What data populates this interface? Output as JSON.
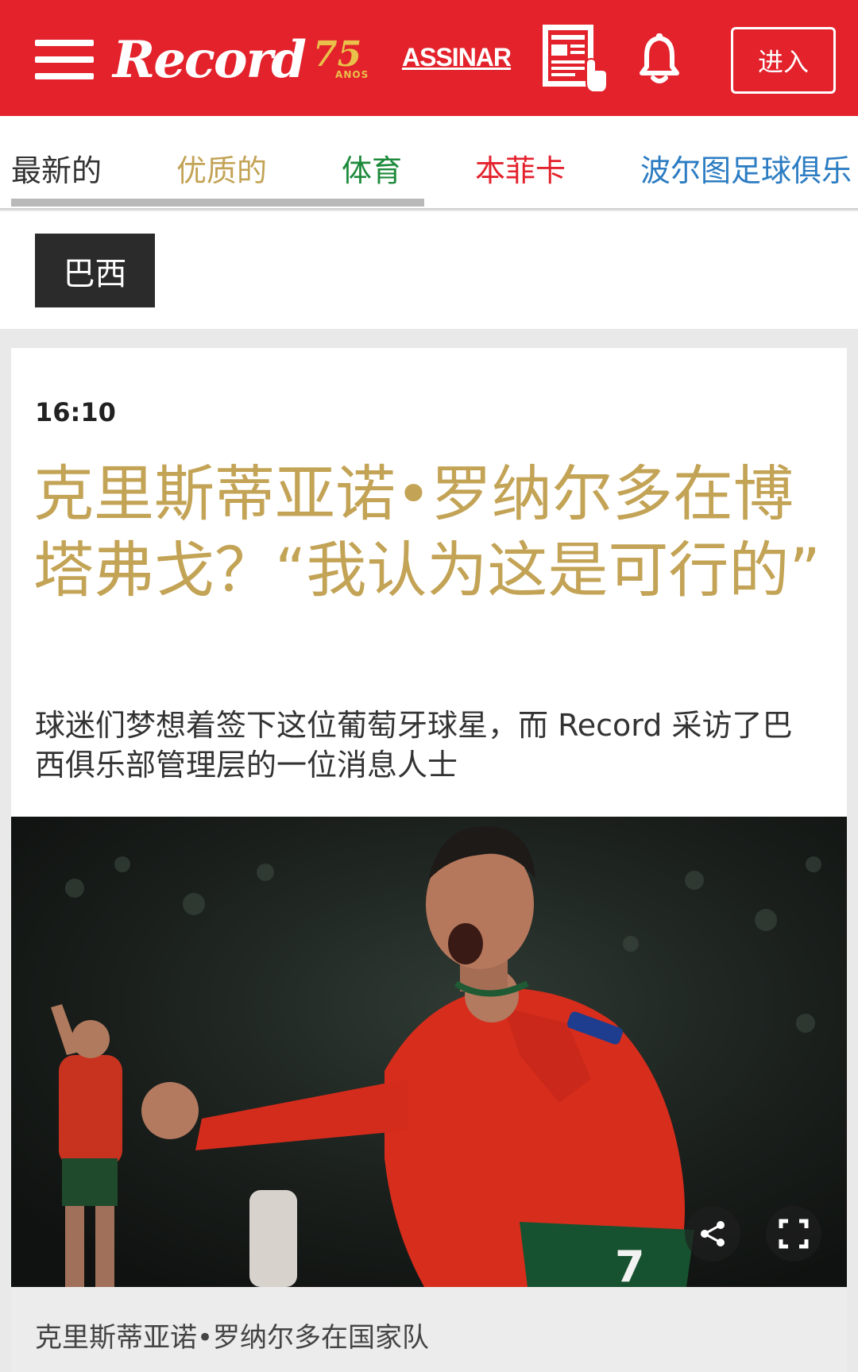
{
  "header": {
    "menu_icon": "hamburger-menu-icon",
    "logo_text": "Record",
    "logo_badge_number": "75",
    "logo_badge_sub": "ANOS",
    "subscribe_label": "ASSINAR",
    "epaper_icon": "newspaper-tap-icon",
    "bell_icon": "bell-icon",
    "login_label": "进入",
    "brand_color": "#e3222c",
    "badge_color": "#e9c14a"
  },
  "tabs": {
    "items": [
      {
        "label": "最新的",
        "color": "#333333"
      },
      {
        "label": "优质的",
        "color": "#c3a355"
      },
      {
        "label": "体育",
        "color": "#1d8a3b"
      },
      {
        "label": "本菲卡",
        "color": "#e3222c"
      },
      {
        "label": "波尔图足球俱乐",
        "color": "#2b7cc2"
      }
    ]
  },
  "section": {
    "label": "巴西"
  },
  "article": {
    "time": "16:10",
    "headline": "克里斯蒂亚诺•罗纳尔多在博塔弗戈？“我认为这是可行的”",
    "subhead": "球迷们梦想着签下这位葡萄牙球星，而 Record 采访了巴西俱乐部管理层的一位消息人士",
    "headline_color": "#c3a355",
    "photo": {
      "share_icon": "share-icon",
      "fullscreen_icon": "fullscreen-icon",
      "jersey_number": "7"
    },
    "caption": "克里斯蒂亚诺•罗纳尔多在国家队"
  }
}
